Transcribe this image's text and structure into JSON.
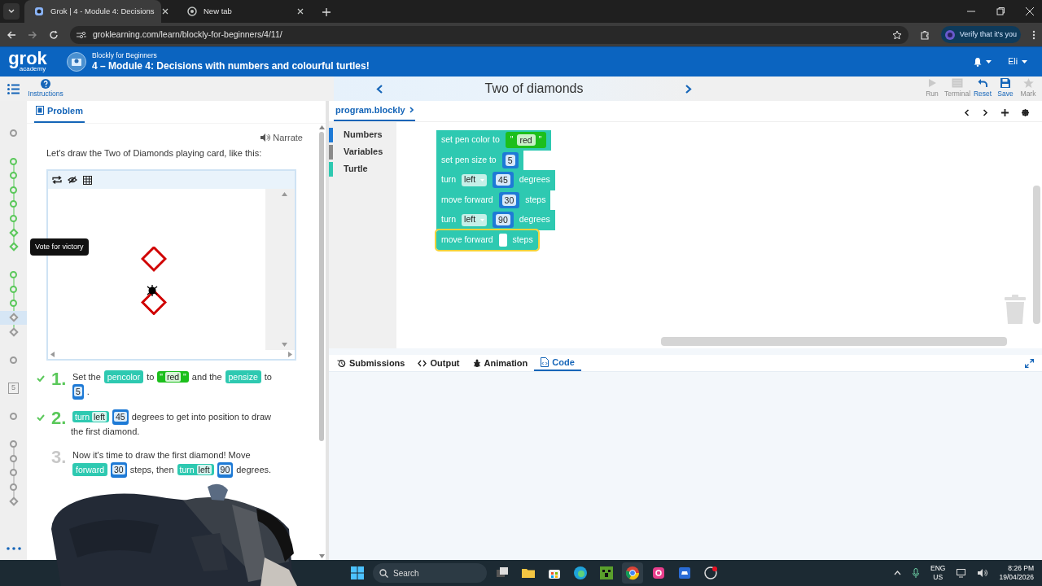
{
  "browser": {
    "tabs": [
      {
        "title": "Grok | 4 - Module 4: Decisions",
        "selected": true
      },
      {
        "title": "New tab",
        "selected": false
      }
    ],
    "url": "groklearning.com/learn/blockly-for-beginners/4/11/",
    "profile_button": "Verify that it's you"
  },
  "header": {
    "logo": {
      "word": "grok",
      "sub": "academy"
    },
    "course": "Blockly for Beginners",
    "module": "4 – Module 4: Decisions with numbers and colourful turtles!",
    "user": "Eli"
  },
  "toolbar": {
    "instructions": "Instructions",
    "problem_title": "Two of diamonds",
    "actions": [
      {
        "kind": "run",
        "label": "Run",
        "disabled": true
      },
      {
        "kind": "terminal",
        "label": "Terminal",
        "disabled": true
      },
      {
        "kind": "reset",
        "label": "Reset",
        "disabled": false
      },
      {
        "kind": "save",
        "label": "Save",
        "disabled": false
      },
      {
        "kind": "mark",
        "label": "Mark",
        "disabled": true
      }
    ]
  },
  "rail": {
    "groups": [
      {
        "nodes": [
          {
            "kind": "circle",
            "done": false,
            "selected": false
          }
        ]
      },
      {
        "nodes": [
          {
            "kind": "circle",
            "done": true,
            "selected": false
          },
          {
            "kind": "circle",
            "done": true,
            "selected": false
          },
          {
            "kind": "circle",
            "done": true,
            "selected": false
          },
          {
            "kind": "circle",
            "done": true,
            "selected": false
          },
          {
            "kind": "circle",
            "done": true,
            "selected": false
          },
          {
            "kind": "diamond",
            "done": true,
            "selected": false
          },
          {
            "kind": "diamond",
            "done": true,
            "selected": false,
            "tooltip": "Vote for victory"
          }
        ]
      },
      {
        "nodes": [
          {
            "kind": "circle",
            "done": true,
            "selected": false
          },
          {
            "kind": "circle",
            "done": true,
            "selected": false
          },
          {
            "kind": "circle",
            "done": true,
            "selected": false
          },
          {
            "kind": "diamond",
            "done": false,
            "selected": true
          },
          {
            "kind": "diamond",
            "done": false,
            "selected": false
          }
        ]
      },
      {
        "nodes": [
          {
            "kind": "circle",
            "done": false,
            "selected": false
          }
        ]
      },
      {
        "nodes": [
          {
            "kind": "number",
            "label": "5",
            "done": false,
            "selected": false
          }
        ]
      },
      {
        "nodes": [
          {
            "kind": "circle",
            "done": false,
            "selected": false
          }
        ]
      },
      {
        "nodes": [
          {
            "kind": "circle",
            "done": false,
            "selected": false
          },
          {
            "kind": "circle",
            "done": false,
            "selected": false
          },
          {
            "kind": "circle",
            "done": false,
            "selected": false
          },
          {
            "kind": "circle",
            "done": false,
            "selected": false
          },
          {
            "kind": "diamond",
            "done": false,
            "selected": false
          }
        ]
      }
    ]
  },
  "problem": {
    "tab": "Problem",
    "narrate": "Narrate",
    "intro": "Let's draw the Two of Diamonds playing card, like this:",
    "steps": [
      {
        "number": "1.",
        "done": true,
        "parts": [
          {
            "kind": "text",
            "text": "Set the"
          },
          {
            "kind": "block",
            "text": "pencolor"
          },
          {
            "kind": "text",
            "text": "to"
          },
          {
            "kind": "string",
            "open": "\"",
            "text": "red",
            "close": "\""
          },
          {
            "kind": "text",
            "text": "and the"
          },
          {
            "kind": "block",
            "text": "pensize"
          },
          {
            "kind": "text",
            "text": "to"
          },
          {
            "kind": "number",
            "text": "5"
          },
          {
            "kind": "text",
            "text": "."
          }
        ]
      },
      {
        "number": "2.",
        "done": true,
        "parts": [
          {
            "kind": "dropdown_block",
            "text": "turn",
            "option": "left"
          },
          {
            "kind": "number",
            "text": "45"
          },
          {
            "kind": "text",
            "text": "degrees to get into position to draw the first diamond."
          }
        ]
      },
      {
        "number": "3.",
        "done": false,
        "parts": [
          {
            "kind": "text",
            "text": "Now it's time to draw the first diamond! Move"
          },
          {
            "kind": "block",
            "text": "forward"
          },
          {
            "kind": "number",
            "text": "30"
          },
          {
            "kind": "text",
            "text": "steps, then"
          },
          {
            "kind": "dropdown_block",
            "text": "turn",
            "option": "left"
          },
          {
            "kind": "number",
            "text": "90"
          },
          {
            "kind": "text",
            "text": "degrees."
          }
        ]
      }
    ]
  },
  "editor": {
    "file_tab": "program.blockly",
    "toolbox": [
      {
        "label": "Numbers",
        "color": "#1e7ad6"
      },
      {
        "label": "Variables",
        "color": "#8a8a8a"
      },
      {
        "label": "Turtle",
        "color": "#2ec9b1"
      }
    ],
    "blocks": [
      {
        "selected": false,
        "parts": [
          {
            "kind": "label",
            "text": "set pen color to"
          },
          {
            "kind": "string",
            "open": "\"",
            "text": "red",
            "close": "\""
          }
        ]
      },
      {
        "selected": false,
        "parts": [
          {
            "kind": "label",
            "text": "set pen size to"
          },
          {
            "kind": "number",
            "text": "5"
          }
        ]
      },
      {
        "selected": false,
        "parts": [
          {
            "kind": "label",
            "text": "turn"
          },
          {
            "kind": "dropdown",
            "text": "left"
          },
          {
            "kind": "number",
            "text": "45"
          },
          {
            "kind": "label",
            "text": "degrees"
          }
        ]
      },
      {
        "selected": false,
        "parts": [
          {
            "kind": "label",
            "text": "move forward"
          },
          {
            "kind": "number",
            "text": "30"
          },
          {
            "kind": "label",
            "text": "steps"
          }
        ]
      },
      {
        "selected": false,
        "parts": [
          {
            "kind": "label",
            "text": "turn"
          },
          {
            "kind": "dropdown",
            "text": "left"
          },
          {
            "kind": "number",
            "text": "90"
          },
          {
            "kind": "label",
            "text": "degrees"
          }
        ]
      },
      {
        "selected": true,
        "parts": [
          {
            "kind": "label",
            "text": "move forward"
          },
          {
            "kind": "empty"
          },
          {
            "kind": "label",
            "text": "steps"
          }
        ]
      }
    ],
    "bottom_tabs": [
      {
        "kind": "submissions",
        "label": "Submissions",
        "selected": false
      },
      {
        "kind": "output",
        "label": "Output",
        "selected": false
      },
      {
        "kind": "animation",
        "label": "Animation",
        "selected": false
      },
      {
        "kind": "code",
        "label": "Code",
        "selected": true
      }
    ]
  },
  "taskbar": {
    "search": "Search",
    "language": "ENG",
    "region": "US",
    "time": "8:26 PM",
    "date": "19/04/2026"
  }
}
